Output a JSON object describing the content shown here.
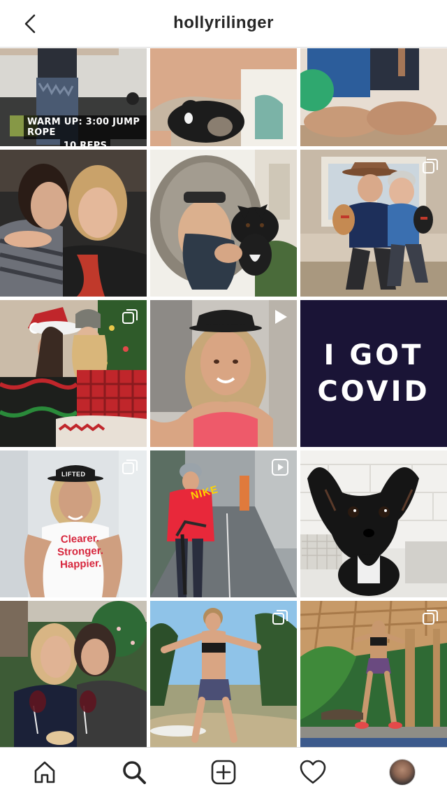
{
  "header": {
    "title": "hollyrilinger"
  },
  "posts": {
    "p0": {
      "overlay_line1": "WARM UP: 3:00 JUMP ROPE",
      "overlay_line2": "10 REPS"
    },
    "p8": {
      "line1": "I GOT",
      "line2": "COVID"
    },
    "p9": {
      "cap_text": "LIFTED",
      "shirt_line1": "Clearer.",
      "shirt_line2": "Stronger.",
      "shirt_line3": "Happier."
    },
    "p10": {
      "hoodie_text": "NIKE"
    }
  },
  "tabbar": {
    "items": [
      "home-icon",
      "search-icon",
      "new-post-icon",
      "activity-heart-icon",
      "profile-avatar"
    ]
  },
  "colors": {
    "accent_dark": "#1a1436",
    "border": "#dbdbdb",
    "text": "#262626"
  }
}
